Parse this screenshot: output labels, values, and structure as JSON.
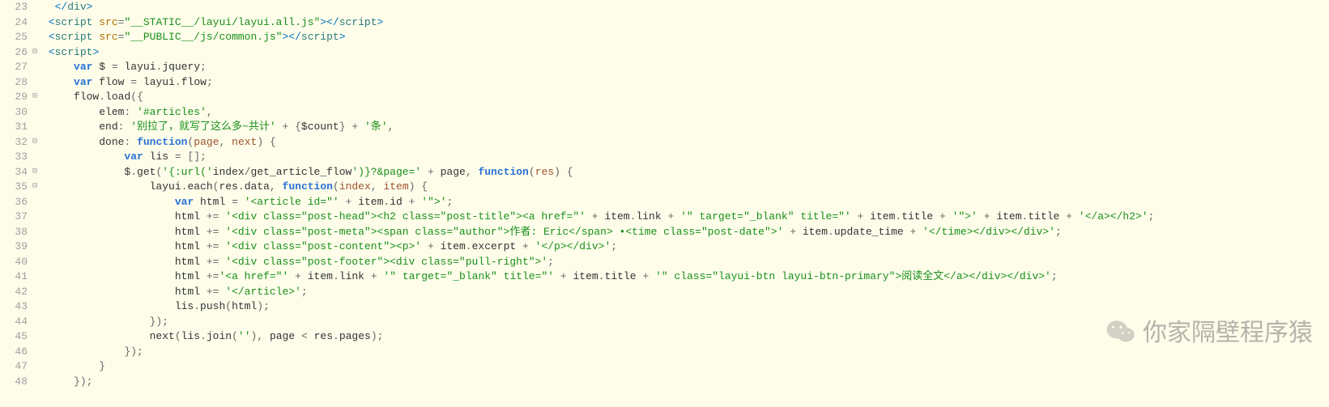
{
  "watermark": {
    "text": "你家隔壁程序猿"
  },
  "lines": [
    {
      "n": 23,
      "fold": "",
      "tokens": [
        [
          "sp",
          "  "
        ],
        [
          "t-tag",
          "</"
        ],
        [
          "t-elem",
          "div"
        ],
        [
          "t-tag",
          ">"
        ]
      ]
    },
    {
      "n": 24,
      "fold": "",
      "tokens": [
        [
          "sp",
          " "
        ],
        [
          "t-tag",
          "<"
        ],
        [
          "t-elem",
          "script "
        ],
        [
          "t-attr",
          "src"
        ],
        [
          "t-punc",
          "="
        ],
        [
          "t-str",
          "\"__STATIC__/layui/layui.all.js\""
        ],
        [
          "t-tag",
          "></"
        ],
        [
          "t-elem",
          "script"
        ],
        [
          "t-tag",
          ">"
        ]
      ]
    },
    {
      "n": 25,
      "fold": "",
      "tokens": [
        [
          "sp",
          " "
        ],
        [
          "t-tag",
          "<"
        ],
        [
          "t-elem",
          "script "
        ],
        [
          "t-attr",
          "src"
        ],
        [
          "t-punc",
          "="
        ],
        [
          "t-str",
          "\"__PUBLIC__/js/common.js\""
        ],
        [
          "t-tag",
          "></"
        ],
        [
          "t-elem",
          "script"
        ],
        [
          "t-tag",
          ">"
        ]
      ]
    },
    {
      "n": 26,
      "fold": "⊟",
      "tokens": [
        [
          "sp",
          " "
        ],
        [
          "t-tag",
          "<"
        ],
        [
          "t-elem",
          "script"
        ],
        [
          "t-tag",
          ">"
        ]
      ]
    },
    {
      "n": 27,
      "fold": "",
      "tokens": [
        [
          "sp",
          "     "
        ],
        [
          "t-kw",
          "var"
        ],
        [
          "sp",
          " "
        ],
        [
          "t-id",
          "$"
        ],
        [
          "sp",
          " "
        ],
        [
          "t-op",
          "="
        ],
        [
          "sp",
          " "
        ],
        [
          "t-id",
          "layui"
        ],
        [
          "t-punc",
          "."
        ],
        [
          "t-prop",
          "jquery"
        ],
        [
          "t-punc",
          ";"
        ]
      ]
    },
    {
      "n": 28,
      "fold": "",
      "tokens": [
        [
          "sp",
          "     "
        ],
        [
          "t-kw",
          "var"
        ],
        [
          "sp",
          " "
        ],
        [
          "t-id",
          "flow"
        ],
        [
          "sp",
          " "
        ],
        [
          "t-op",
          "="
        ],
        [
          "sp",
          " "
        ],
        [
          "t-id",
          "layui"
        ],
        [
          "t-punc",
          "."
        ],
        [
          "t-prop",
          "flow"
        ],
        [
          "t-punc",
          ";"
        ]
      ]
    },
    {
      "n": 29,
      "fold": "⊟",
      "tokens": [
        [
          "sp",
          "     "
        ],
        [
          "t-id",
          "flow"
        ],
        [
          "t-punc",
          "."
        ],
        [
          "t-meth",
          "load"
        ],
        [
          "t-brkt",
          "({"
        ]
      ]
    },
    {
      "n": 30,
      "fold": "",
      "tokens": [
        [
          "sp",
          "         "
        ],
        [
          "t-prop",
          "elem"
        ],
        [
          "t-punc",
          ":"
        ],
        [
          "sp",
          " "
        ],
        [
          "t-str",
          "'#articles'"
        ],
        [
          "t-punc",
          ","
        ]
      ]
    },
    {
      "n": 31,
      "fold": "",
      "tokens": [
        [
          "sp",
          "         "
        ],
        [
          "t-prop",
          "end"
        ],
        [
          "t-punc",
          ":"
        ],
        [
          "sp",
          " "
        ],
        [
          "t-str",
          "'别拉了，就写了这么多~共计'"
        ],
        [
          "sp",
          " "
        ],
        [
          "t-op",
          "+"
        ],
        [
          "sp",
          " "
        ],
        [
          "t-brkt",
          "{"
        ],
        [
          "t-id",
          "$count"
        ],
        [
          "t-brkt",
          "}"
        ],
        [
          "sp",
          " "
        ],
        [
          "t-op",
          "+"
        ],
        [
          "sp",
          " "
        ],
        [
          "t-str",
          "'条'"
        ],
        [
          "t-punc",
          ","
        ]
      ]
    },
    {
      "n": 32,
      "fold": "⊟",
      "tokens": [
        [
          "sp",
          "         "
        ],
        [
          "t-prop",
          "done"
        ],
        [
          "t-punc",
          ":"
        ],
        [
          "sp",
          " "
        ],
        [
          "t-kw",
          "function"
        ],
        [
          "t-brkt",
          "("
        ],
        [
          "t-param",
          "page"
        ],
        [
          "t-punc",
          ","
        ],
        [
          "sp",
          " "
        ],
        [
          "t-param",
          "next"
        ],
        [
          "t-brkt",
          ")"
        ],
        [
          "sp",
          " "
        ],
        [
          "t-brkt",
          "{"
        ]
      ]
    },
    {
      "n": 33,
      "fold": "",
      "tokens": [
        [
          "sp",
          "             "
        ],
        [
          "t-kw",
          "var"
        ],
        [
          "sp",
          " "
        ],
        [
          "t-id",
          "lis"
        ],
        [
          "sp",
          " "
        ],
        [
          "t-op",
          "="
        ],
        [
          "sp",
          " "
        ],
        [
          "t-brkt",
          "[]"
        ],
        [
          "t-punc",
          ";"
        ]
      ]
    },
    {
      "n": 34,
      "fold": "⊟",
      "tokens": [
        [
          "sp",
          "             "
        ],
        [
          "t-id",
          "$"
        ],
        [
          "t-punc",
          "."
        ],
        [
          "t-meth",
          "get"
        ],
        [
          "t-brkt",
          "("
        ],
        [
          "t-str",
          "'{:url('"
        ],
        [
          "t-id",
          "index"
        ],
        [
          "t-op",
          "/"
        ],
        [
          "t-id",
          "get_article_flow"
        ],
        [
          "t-str",
          "')}?&page='"
        ],
        [
          "sp",
          " "
        ],
        [
          "t-op",
          "+"
        ],
        [
          "sp",
          " "
        ],
        [
          "t-id",
          "page"
        ],
        [
          "t-punc",
          ","
        ],
        [
          "sp",
          " "
        ],
        [
          "t-kw",
          "function"
        ],
        [
          "t-brkt",
          "("
        ],
        [
          "t-param",
          "res"
        ],
        [
          "t-brkt",
          ")"
        ],
        [
          "sp",
          " "
        ],
        [
          "t-brkt",
          "{"
        ]
      ]
    },
    {
      "n": 35,
      "fold": "⊟",
      "tokens": [
        [
          "sp",
          "                 "
        ],
        [
          "t-id",
          "layui"
        ],
        [
          "t-punc",
          "."
        ],
        [
          "t-meth",
          "each"
        ],
        [
          "t-brkt",
          "("
        ],
        [
          "t-id",
          "res"
        ],
        [
          "t-punc",
          "."
        ],
        [
          "t-prop",
          "data"
        ],
        [
          "t-punc",
          ","
        ],
        [
          "sp",
          " "
        ],
        [
          "t-kw",
          "function"
        ],
        [
          "t-brkt",
          "("
        ],
        [
          "t-param",
          "index"
        ],
        [
          "t-punc",
          ","
        ],
        [
          "sp",
          " "
        ],
        [
          "t-param",
          "item"
        ],
        [
          "t-brkt",
          ")"
        ],
        [
          "sp",
          " "
        ],
        [
          "t-brkt",
          "{"
        ]
      ]
    },
    {
      "n": 36,
      "fold": "",
      "tokens": [
        [
          "sp",
          "                     "
        ],
        [
          "t-kw",
          "var"
        ],
        [
          "sp",
          " "
        ],
        [
          "t-id",
          "html"
        ],
        [
          "sp",
          " "
        ],
        [
          "t-op",
          "="
        ],
        [
          "sp",
          " "
        ],
        [
          "t-str",
          "'<article id=\"'"
        ],
        [
          "sp",
          " "
        ],
        [
          "t-op",
          "+"
        ],
        [
          "sp",
          " "
        ],
        [
          "t-id",
          "item"
        ],
        [
          "t-punc",
          "."
        ],
        [
          "t-prop",
          "id"
        ],
        [
          "sp",
          " "
        ],
        [
          "t-op",
          "+"
        ],
        [
          "sp",
          " "
        ],
        [
          "t-str",
          "'\">'"
        ],
        [
          "t-punc",
          ";"
        ]
      ]
    },
    {
      "n": 37,
      "fold": "",
      "tokens": [
        [
          "sp",
          "                     "
        ],
        [
          "t-id",
          "html"
        ],
        [
          "sp",
          " "
        ],
        [
          "t-op",
          "+="
        ],
        [
          "sp",
          " "
        ],
        [
          "t-str",
          "'<div class=\"post-head\"><h2 class=\"post-title\"><a href=\"'"
        ],
        [
          "sp",
          " "
        ],
        [
          "t-op",
          "+"
        ],
        [
          "sp",
          " "
        ],
        [
          "t-id",
          "item"
        ],
        [
          "t-punc",
          "."
        ],
        [
          "t-prop",
          "link"
        ],
        [
          "sp",
          " "
        ],
        [
          "t-op",
          "+"
        ],
        [
          "sp",
          " "
        ],
        [
          "t-str",
          "'\" target=\"_blank\" title=\"'"
        ],
        [
          "sp",
          " "
        ],
        [
          "t-op",
          "+"
        ],
        [
          "sp",
          " "
        ],
        [
          "t-id",
          "item"
        ],
        [
          "t-punc",
          "."
        ],
        [
          "t-prop",
          "title"
        ],
        [
          "sp",
          " "
        ],
        [
          "t-op",
          "+"
        ],
        [
          "sp",
          " "
        ],
        [
          "t-str",
          "'\">'"
        ],
        [
          "sp",
          " "
        ],
        [
          "t-op",
          "+"
        ],
        [
          "sp",
          " "
        ],
        [
          "t-id",
          "item"
        ],
        [
          "t-punc",
          "."
        ],
        [
          "t-prop",
          "title"
        ],
        [
          "sp",
          " "
        ],
        [
          "t-op",
          "+"
        ],
        [
          "sp",
          " "
        ],
        [
          "t-str",
          "'</a></h2>'"
        ],
        [
          "t-punc",
          ";"
        ]
      ]
    },
    {
      "n": 38,
      "fold": "",
      "tokens": [
        [
          "sp",
          "                     "
        ],
        [
          "t-id",
          "html"
        ],
        [
          "sp",
          " "
        ],
        [
          "t-op",
          "+="
        ],
        [
          "sp",
          " "
        ],
        [
          "t-str",
          "'<div class=\"post-meta\"><span class=\"author\">作者: Eric</span> •<time class=\"post-date\">'"
        ],
        [
          "sp",
          " "
        ],
        [
          "t-op",
          "+"
        ],
        [
          "sp",
          " "
        ],
        [
          "t-id",
          "item"
        ],
        [
          "t-punc",
          "."
        ],
        [
          "t-prop",
          "update_time"
        ],
        [
          "sp",
          " "
        ],
        [
          "t-op",
          "+"
        ],
        [
          "sp",
          " "
        ],
        [
          "t-str",
          "'</time></div></div>'"
        ],
        [
          "t-punc",
          ";"
        ]
      ]
    },
    {
      "n": 39,
      "fold": "",
      "tokens": [
        [
          "sp",
          "                     "
        ],
        [
          "t-id",
          "html"
        ],
        [
          "sp",
          " "
        ],
        [
          "t-op",
          "+="
        ],
        [
          "sp",
          " "
        ],
        [
          "t-str",
          "'<div class=\"post-content\"><p>'"
        ],
        [
          "sp",
          " "
        ],
        [
          "t-op",
          "+"
        ],
        [
          "sp",
          " "
        ],
        [
          "t-id",
          "item"
        ],
        [
          "t-punc",
          "."
        ],
        [
          "t-prop",
          "excerpt"
        ],
        [
          "sp",
          " "
        ],
        [
          "t-op",
          "+"
        ],
        [
          "sp",
          " "
        ],
        [
          "t-str",
          "'</p></div>'"
        ],
        [
          "t-punc",
          ";"
        ]
      ]
    },
    {
      "n": 40,
      "fold": "",
      "tokens": [
        [
          "sp",
          "                     "
        ],
        [
          "t-id",
          "html"
        ],
        [
          "sp",
          " "
        ],
        [
          "t-op",
          "+="
        ],
        [
          "sp",
          " "
        ],
        [
          "t-str",
          "'<div class=\"post-footer\"><div class=\"pull-right\">'"
        ],
        [
          "t-punc",
          ";"
        ]
      ]
    },
    {
      "n": 41,
      "fold": "",
      "tokens": [
        [
          "sp",
          "                     "
        ],
        [
          "t-id",
          "html"
        ],
        [
          "sp",
          " "
        ],
        [
          "t-op",
          "+="
        ],
        [
          "t-str",
          "'<a href=\"'"
        ],
        [
          "sp",
          " "
        ],
        [
          "t-op",
          "+"
        ],
        [
          "sp",
          " "
        ],
        [
          "t-id",
          "item"
        ],
        [
          "t-punc",
          "."
        ],
        [
          "t-prop",
          "link"
        ],
        [
          "sp",
          " "
        ],
        [
          "t-op",
          "+"
        ],
        [
          "sp",
          " "
        ],
        [
          "t-str",
          "'\" target=\"_blank\" title=\"'"
        ],
        [
          "sp",
          " "
        ],
        [
          "t-op",
          "+"
        ],
        [
          "sp",
          " "
        ],
        [
          "t-id",
          "item"
        ],
        [
          "t-punc",
          "."
        ],
        [
          "t-prop",
          "title"
        ],
        [
          "sp",
          " "
        ],
        [
          "t-op",
          "+"
        ],
        [
          "sp",
          " "
        ],
        [
          "t-str",
          "'\" class=\"layui-btn layui-btn-primary\">阅读全文</a></div></div>'"
        ],
        [
          "t-punc",
          ";"
        ]
      ]
    },
    {
      "n": 42,
      "fold": "",
      "tokens": [
        [
          "sp",
          "                     "
        ],
        [
          "t-id",
          "html"
        ],
        [
          "sp",
          " "
        ],
        [
          "t-op",
          "+="
        ],
        [
          "sp",
          " "
        ],
        [
          "t-str",
          "'</article>'"
        ],
        [
          "t-punc",
          ";"
        ]
      ]
    },
    {
      "n": 43,
      "fold": "",
      "tokens": [
        [
          "sp",
          "                     "
        ],
        [
          "t-id",
          "lis"
        ],
        [
          "t-punc",
          "."
        ],
        [
          "t-meth",
          "push"
        ],
        [
          "t-brkt",
          "("
        ],
        [
          "t-id",
          "html"
        ],
        [
          "t-brkt",
          ")"
        ],
        [
          "t-punc",
          ";"
        ]
      ]
    },
    {
      "n": 44,
      "fold": "",
      "tokens": [
        [
          "sp",
          "                 "
        ],
        [
          "t-brkt",
          "})"
        ],
        [
          "t-punc",
          ";"
        ]
      ]
    },
    {
      "n": 45,
      "fold": "",
      "tokens": [
        [
          "sp",
          "                 "
        ],
        [
          "t-meth",
          "next"
        ],
        [
          "t-brkt",
          "("
        ],
        [
          "t-id",
          "lis"
        ],
        [
          "t-punc",
          "."
        ],
        [
          "t-meth",
          "join"
        ],
        [
          "t-brkt",
          "("
        ],
        [
          "t-str",
          "''"
        ],
        [
          "t-brkt",
          ")"
        ],
        [
          "t-punc",
          ","
        ],
        [
          "sp",
          " "
        ],
        [
          "t-id",
          "page"
        ],
        [
          "sp",
          " "
        ],
        [
          "t-op",
          "<"
        ],
        [
          "sp",
          " "
        ],
        [
          "t-id",
          "res"
        ],
        [
          "t-punc",
          "."
        ],
        [
          "t-prop",
          "pages"
        ],
        [
          "t-brkt",
          ")"
        ],
        [
          "t-punc",
          ";"
        ]
      ]
    },
    {
      "n": 46,
      "fold": "",
      "tokens": [
        [
          "sp",
          "             "
        ],
        [
          "t-brkt",
          "})"
        ],
        [
          "t-punc",
          ";"
        ]
      ]
    },
    {
      "n": 47,
      "fold": "",
      "tokens": [
        [
          "sp",
          "         "
        ],
        [
          "t-brkt",
          "}"
        ]
      ]
    },
    {
      "n": 48,
      "fold": "",
      "tokens": [
        [
          "sp",
          "     "
        ],
        [
          "t-brkt",
          "})"
        ],
        [
          "t-punc",
          ";"
        ]
      ]
    }
  ]
}
